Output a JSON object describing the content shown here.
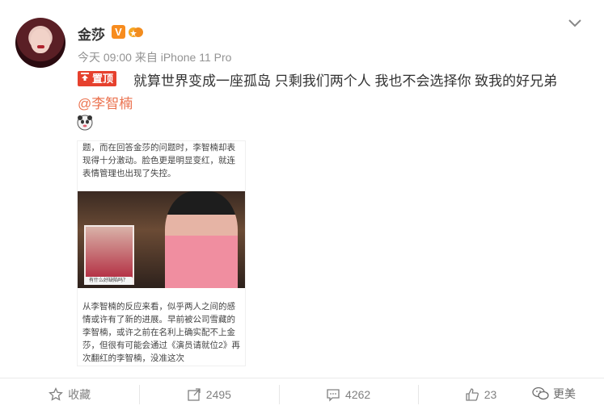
{
  "post": {
    "author": "金莎",
    "verified_badge": "V",
    "time": "今天 09:00",
    "source": "来自 iPhone 11 Pro",
    "pinned_label": "置顶",
    "text": "就算世界变成一座孤岛 只剩我们两个人 我也不会选择你  致我的好兄弟",
    "mention": "@李智楠"
  },
  "image": {
    "top_text": "题，而在回答金莎的问题时，李智楠却表现得十分激动。脸色更是明显变红，就连表情管理也出现了失控。",
    "bottom_text": "从李智楠的反应来看，似乎两人之间的感情或许有了新的进展。早前被公司雪藏的李智楠，或许之前在名利上确实配不上金莎，但很有可能会通过《演员请就位2》再次翻红的李智楠，没准这次",
    "scene_caption": "有什么好缺陷吗？"
  },
  "actions": {
    "favorite_label": "收藏",
    "repost_count": "2495",
    "comment_count": "4262",
    "like_count": "23"
  },
  "watermark": {
    "text": "更美"
  },
  "colors": {
    "accent_orange": "#eb7350",
    "pin_red": "#e6412e",
    "badge_orange": "#f78c1e",
    "meta_gray": "#939393"
  },
  "icons": {
    "menu": "chevron-down-icon",
    "favorite": "star-icon",
    "repost": "repost-icon",
    "comment": "comment-icon",
    "like": "thumbs-up-icon",
    "emoji": "panda-emoji-icon"
  }
}
